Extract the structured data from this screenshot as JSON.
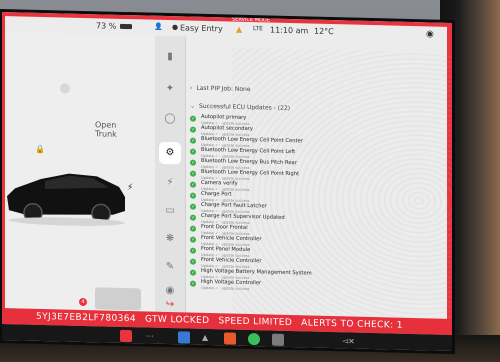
{
  "status_bar": {
    "battery_pct": "73 %",
    "profile": "Easy Entry",
    "network": "LTE",
    "time": "11:10 am",
    "temp": "12°C",
    "top_banner": "SERVICE MODE"
  },
  "car_panel": {
    "open_trunk_top": "Open",
    "open_trunk_bottom": "Trunk",
    "alert_count": "4"
  },
  "menu_icons": [
    "car-icon",
    "tools-icon",
    "steering-wheel-icon",
    "service-gear-icon",
    "lightning-icon",
    "battery-icon",
    "fan-icon",
    "pencil-icon",
    "tire-icon",
    "exit-icon"
  ],
  "sections": {
    "last_job": "Last PIP Job: None",
    "successful": "Successful ECU Updates - (22)"
  },
  "ecu_items": [
    {
      "name": "Autopilot primary",
      "status": "Update ✓ · update success"
    },
    {
      "name": "Autopilot secondary",
      "status": "Update ✓ · update success"
    },
    {
      "name": "Bluetooth Low Energy Cell Point Center",
      "status": "Update ✓ · update success"
    },
    {
      "name": "Bluetooth Low Energy Cell Point Left",
      "status": "Update ✓ · update success"
    },
    {
      "name": "Bluetooth Low Energy Bus Pitch Rear",
      "status": "Update ✓ · update success"
    },
    {
      "name": "Bluetooth Low Energy Cell Point Right",
      "status": "Update ✓ · update success"
    },
    {
      "name": "Camera verify",
      "status": "Update ✓ · update success"
    },
    {
      "name": "Charge Port",
      "status": "Update ✓ · update success"
    },
    {
      "name": "Charge Port Fault Latcher",
      "status": "Update ✓ · update success"
    },
    {
      "name": "Charge Port Supervisor Updated",
      "status": "Update ✓ · update success"
    },
    {
      "name": "Front Door Frontal",
      "status": "Update ✓ · update success"
    },
    {
      "name": "Front Vehicle Controller",
      "status": "Update ✓ · update success"
    },
    {
      "name": "Front Panel Module",
      "status": "Update ✓ · update success"
    },
    {
      "name": "Front Vehicle Controller",
      "status": "Update ✓ · update success"
    },
    {
      "name": "High Voltage Battery Management System",
      "status": "Update ✓ · update success"
    },
    {
      "name": "High Voltage Controller",
      "status": "Update ✓ · update success"
    }
  ],
  "banner": {
    "vin": "5YJ3E7EB2LF780364",
    "gtw": "GTW LOCKED",
    "speed": "SPEED LIMITED",
    "alerts": "ALERTS TO CHECK: 1"
  },
  "colors": {
    "service_red": "#e8343f",
    "success_green": "#3fae4a"
  }
}
